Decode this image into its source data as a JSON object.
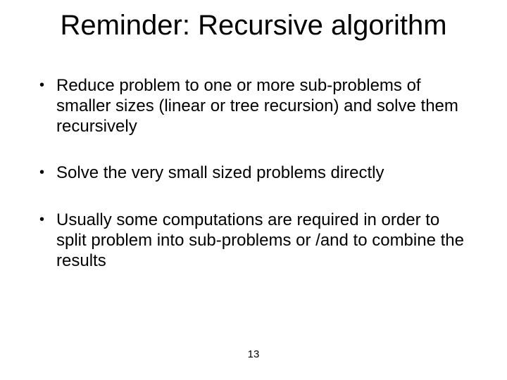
{
  "slide": {
    "title": "Reminder: Recursive algorithm",
    "bullets": [
      "Reduce problem to one or more sub-problems of smaller  sizes (linear or tree recursion) and solve them recursively",
      "Solve the very small sized problems directly",
      "Usually some computations are required in order to split problem into sub-problems or /and to combine the results"
    ],
    "page_number": "13"
  }
}
